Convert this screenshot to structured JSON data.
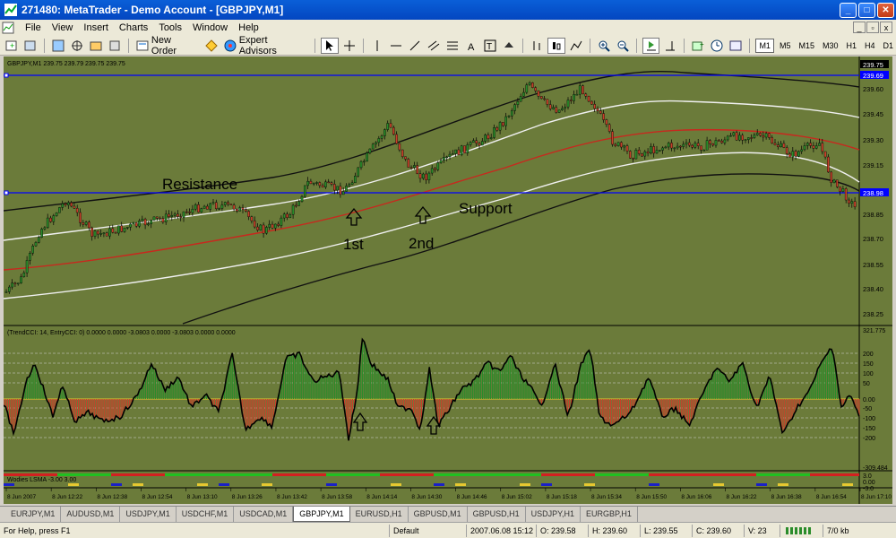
{
  "window": {
    "title": "271480: MetaTrader - Demo Account - [GBPJPY,M1]"
  },
  "menu": [
    "File",
    "View",
    "Insert",
    "Charts",
    "Tools",
    "Window",
    "Help"
  ],
  "toolbar": {
    "new_order": "New Order",
    "expert_advisors": "Expert Advisors",
    "timeframes": [
      "M1",
      "M5",
      "M15",
      "M30",
      "H1",
      "H4",
      "D1"
    ],
    "active_tf": "M1"
  },
  "chart": {
    "header": "GBPJPY,M1  239.75 239.79 239.75 239.75",
    "price_labels": [
      "239.75",
      "239.69",
      "239.60",
      "239.45",
      "239.30",
      "239.15",
      "238.98",
      "238.85",
      "238.70",
      "238.55",
      "238.40",
      "238.25"
    ],
    "annotations": {
      "resistance": "Resistance",
      "support": "Support",
      "first": "1st",
      "second": "2nd"
    },
    "cci_header": "(TrendCCI: 14, EntryCCI: 0)  0.0000 0.0000 -3.0803 0.0000 -3.0803 0.0000 0.0000",
    "cci_labels": [
      "321.775",
      "200",
      "150",
      "100",
      "50",
      "0.00",
      "-50",
      "-100",
      "-150",
      "-200",
      "-309.484"
    ],
    "woodies_header": "Wodies LSMA -3.00 3.00",
    "woodies_labels": [
      "3.0",
      "0.00",
      "-3.0"
    ],
    "time_labels": [
      "8 Jun 2007",
      "8 Jun 12:22",
      "8 Jun 12:38",
      "8 Jun 12:54",
      "8 Jun 13:10",
      "8 Jun 13:26",
      "8 Jun 13:42",
      "8 Jun 13:58",
      "8 Jun 14:14",
      "8 Jun 14:30",
      "8 Jun 14:46",
      "8 Jun 15:02",
      "8 Jun 15:18",
      "8 Jun 15:34",
      "8 Jun 15:50",
      "8 Jun 16:06",
      "8 Jun 16:22",
      "8 Jun 16:38",
      "8 Jun 16:54",
      "8 Jun 17:10"
    ]
  },
  "tabs": [
    "EURJPY,M1",
    "AUDUSD,M1",
    "USDJPY,M1",
    "USDCHF,M1",
    "USDCAD,M1",
    "GBPJPY,M1",
    "EURUSD,H1",
    "GBPUSD,M1",
    "GBPUSD,H1",
    "USDJPY,H1",
    "EURGBP,H1"
  ],
  "active_tab": "GBPJPY,M1",
  "status": {
    "help": "For Help, press F1",
    "profile": "Default",
    "datetime": "2007.06.08 15:12",
    "open": "O: 239.58",
    "high": "H: 239.60",
    "low": "L: 239.55",
    "close": "C: 239.60",
    "volume": "V: 23",
    "traffic": "7/0 kb"
  },
  "colors": {
    "chart_bg": "#6b7b3a",
    "hline": "#0000ff",
    "ma_red": "#c8281e",
    "bull": "#2a8c2a",
    "bear": "#c8402a"
  }
}
